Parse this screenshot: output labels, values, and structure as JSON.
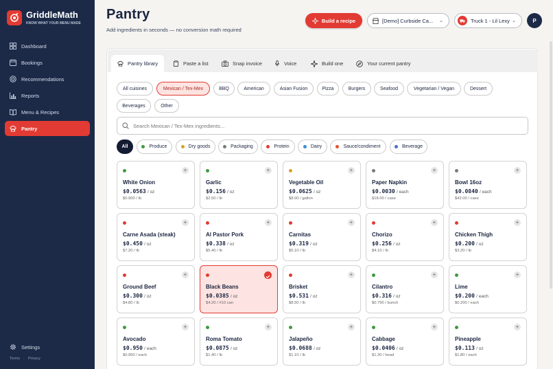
{
  "brand": {
    "name": "GriddleMath",
    "tagline": "KNOW WHAT YOUR MENU MADE"
  },
  "nav": [
    {
      "label": "Dashboard",
      "icon": "grid-icon"
    },
    {
      "label": "Bookings",
      "icon": "calendar-icon"
    },
    {
      "label": "Recommendations",
      "icon": "target-icon"
    },
    {
      "label": "Reports",
      "icon": "bar-chart-icon"
    },
    {
      "label": "Menu & Recipes",
      "icon": "book-icon"
    },
    {
      "label": "Pantry",
      "icon": "chef-hat-icon",
      "active": true
    }
  ],
  "settings": "Settings",
  "footer": {
    "terms": "Terms",
    "dot": "·",
    "privacy": "Privacy"
  },
  "header": {
    "title": "Pantry",
    "subtitle": "Add ingredients in seconds — no conversion math required",
    "build_recipe": "Build a recipe",
    "location_select": "[Demo] Curbside Ca...",
    "truck_select": "Truck 1 - Lil Lexy",
    "avatar": "P"
  },
  "tabs": [
    {
      "label": "Pantry library",
      "icon": "chef-hat-icon",
      "active": true
    },
    {
      "label": "Paste a list",
      "icon": "clipboard-icon"
    },
    {
      "label": "Snap invoice",
      "icon": "camera-icon"
    },
    {
      "label": "Voice",
      "icon": "microphone-icon"
    },
    {
      "label": "Build one",
      "icon": "sparkle-icon"
    },
    {
      "label": "Your current pantry",
      "icon": "compass-icon"
    }
  ],
  "cuisines": [
    "All cuisines",
    "Mexican / Tex-Mex",
    "BBQ",
    "American",
    "Asian Fusion",
    "Pizza",
    "Burgers",
    "Seafood",
    "Vegetarian / Vegan",
    "Dessert",
    "Beverages",
    "Other"
  ],
  "active_cuisine": "Mexican / Tex-Mex",
  "search_placeholder": "Search Mexican / Tex-Mex ingredients...",
  "categories": [
    {
      "label": "All",
      "color": ""
    },
    {
      "label": "Produce",
      "color": "#3f9a3f"
    },
    {
      "label": "Dry goods",
      "color": "#d9a02a"
    },
    {
      "label": "Packaging",
      "color": "#7b7b7b"
    },
    {
      "label": "Protein",
      "color": "#e23b33"
    },
    {
      "label": "Dairy",
      "color": "#3c8fd1"
    },
    {
      "label": "Sauce/condiment",
      "color": "#e2552e"
    },
    {
      "label": "Beverage",
      "color": "#4a6fc9"
    }
  ],
  "colors": {
    "accent": "#e23b33",
    "navy": "#1c2a48",
    "produce": "#3f9a3f",
    "protein": "#e23b33",
    "dry": "#d9a02a",
    "packaging": "#7b7b7b"
  },
  "ingredients": [
    {
      "name": "White Onion",
      "price": "$0.0563",
      "unit": "/ oz",
      "src": "$0.900 / lb",
      "cat": "produce"
    },
    {
      "name": "Garlic",
      "price": "$0.156",
      "unit": "/ oz",
      "src": "$2.50 / lb",
      "cat": "produce"
    },
    {
      "name": "Vegetable Oil",
      "price": "$0.0625",
      "unit": "/ oz",
      "src": "$8.00 / gallon",
      "cat": "dry"
    },
    {
      "name": "Paper Napkin",
      "price": "$0.0030",
      "unit": "/ each",
      "src": "$18.00 / case",
      "cat": "packaging"
    },
    {
      "name": "Bowl 16oz",
      "price": "$0.0840",
      "unit": "/ each",
      "src": "$42.00 / case",
      "cat": "packaging"
    },
    {
      "name": "Carne Asada (steak)",
      "price": "$0.450",
      "unit": "/ oz",
      "src": "$7.20 / lb",
      "cat": "protein"
    },
    {
      "name": "Al Pastor Pork",
      "price": "$0.338",
      "unit": "/ oz",
      "src": "$5.40 / lb",
      "cat": "protein"
    },
    {
      "name": "Carnitas",
      "price": "$0.319",
      "unit": "/ oz",
      "src": "$5.10 / lb",
      "cat": "protein"
    },
    {
      "name": "Chorizo",
      "price": "$0.256",
      "unit": "/ oz",
      "src": "$4.10 / lb",
      "cat": "protein"
    },
    {
      "name": "Chicken Thigh",
      "price": "$0.200",
      "unit": "/ oz",
      "src": "$3.20 / lb",
      "cat": "protein"
    },
    {
      "name": "Ground Beef",
      "price": "$0.300",
      "unit": "/ oz",
      "src": "$4.80 / lb",
      "cat": "protein"
    },
    {
      "name": "Black Beans",
      "price": "$0.0385",
      "unit": "/ oz",
      "src": "$4.20 / #10 can",
      "cat": "protein",
      "selected": true
    },
    {
      "name": "Brisket",
      "price": "$0.531",
      "unit": "/ oz",
      "src": "$8.50 / lb",
      "cat": "protein"
    },
    {
      "name": "Cilantro",
      "price": "$0.316",
      "unit": "/ oz",
      "src": "$0.790 / bunch",
      "cat": "produce"
    },
    {
      "name": "Lime",
      "price": "$0.200",
      "unit": "/ each",
      "src": "$0.200 / each",
      "cat": "produce"
    },
    {
      "name": "Avocado",
      "price": "$0.950",
      "unit": "/ each",
      "src": "$0.950 / each",
      "cat": "produce"
    },
    {
      "name": "Roma Tomato",
      "price": "$0.0875",
      "unit": "/ oz",
      "src": "$1.40 / lb",
      "cat": "produce"
    },
    {
      "name": "Jalapeño",
      "price": "$0.0688",
      "unit": "/ oz",
      "src": "$1.10 / lb",
      "cat": "produce"
    },
    {
      "name": "Cabbage",
      "price": "$0.0406",
      "unit": "/ oz",
      "src": "$1.30 / head",
      "cat": "produce"
    },
    {
      "name": "Pineapple",
      "price": "$0.113",
      "unit": "/ oz",
      "src": "$1.80 / each",
      "cat": "produce"
    }
  ]
}
